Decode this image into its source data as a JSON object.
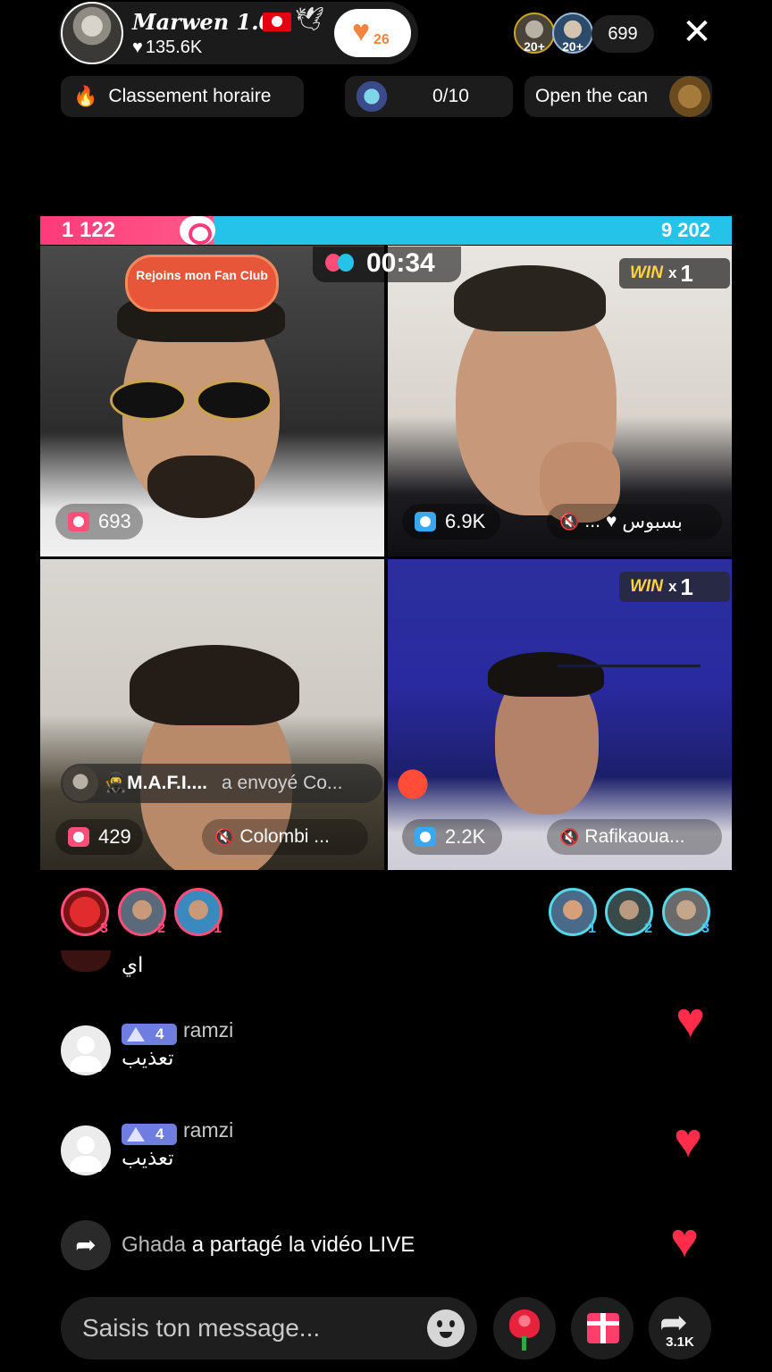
{
  "header": {
    "host_name": "Marwen 1.0",
    "host_likes": "135.6K",
    "fanclub_count": "26",
    "viewer_badges": [
      "20+",
      "20+"
    ],
    "viewer_count": "699"
  },
  "chips": {
    "ranking": "Classement horaire",
    "goal_progress": "0/10",
    "open_can": "Open the can"
  },
  "battle": {
    "score_left": "1 122",
    "score_right": "9 202",
    "timer": "00:34",
    "fan_club_banner": "Rejoins mon Fan Club"
  },
  "tiles": [
    {
      "gift_count": "693",
      "name": ""
    },
    {
      "gift_count": "6.9K",
      "name": "بسبوس",
      "name_prefix": "...",
      "win_label": "WIN",
      "win_x": "x",
      "win_count": "1"
    },
    {
      "gift_count": "429",
      "name": "Colombi ..."
    },
    {
      "gift_count": "2.2K",
      "name": "Rafikaoua...",
      "win_label": "WIN",
      "win_x": "x",
      "win_count": "1"
    }
  ],
  "gift_notice": {
    "sender": "M.A.F.I....",
    "action": "a envoyé  Co..."
  },
  "supporters": {
    "left_ranks": [
      "3",
      "2",
      "1"
    ],
    "right_ranks": [
      "1",
      "2",
      "3"
    ]
  },
  "chat": {
    "partial_message": "اي",
    "messages": [
      {
        "level": "4",
        "user": "ramzi",
        "text": "تعذيب"
      },
      {
        "level": "4",
        "user": "ramzi",
        "text": "تعذيب"
      }
    ],
    "share_user": "Ghada",
    "share_text": "a partagé la vidéo LIVE"
  },
  "bottom": {
    "input_placeholder": "Saisis ton message...",
    "share_count": "3.1K"
  },
  "colors": {
    "team_pink": "#ff3a7a",
    "team_blue": "#25c3e8",
    "heart_red": "#ff2d4a",
    "level_badge": "#6f7de0"
  },
  "icons": [
    "close-icon",
    "fire-icon",
    "heart-icon",
    "mute-icon",
    "share-icon",
    "emoji-icon",
    "rose-icon",
    "gift-icon"
  ]
}
